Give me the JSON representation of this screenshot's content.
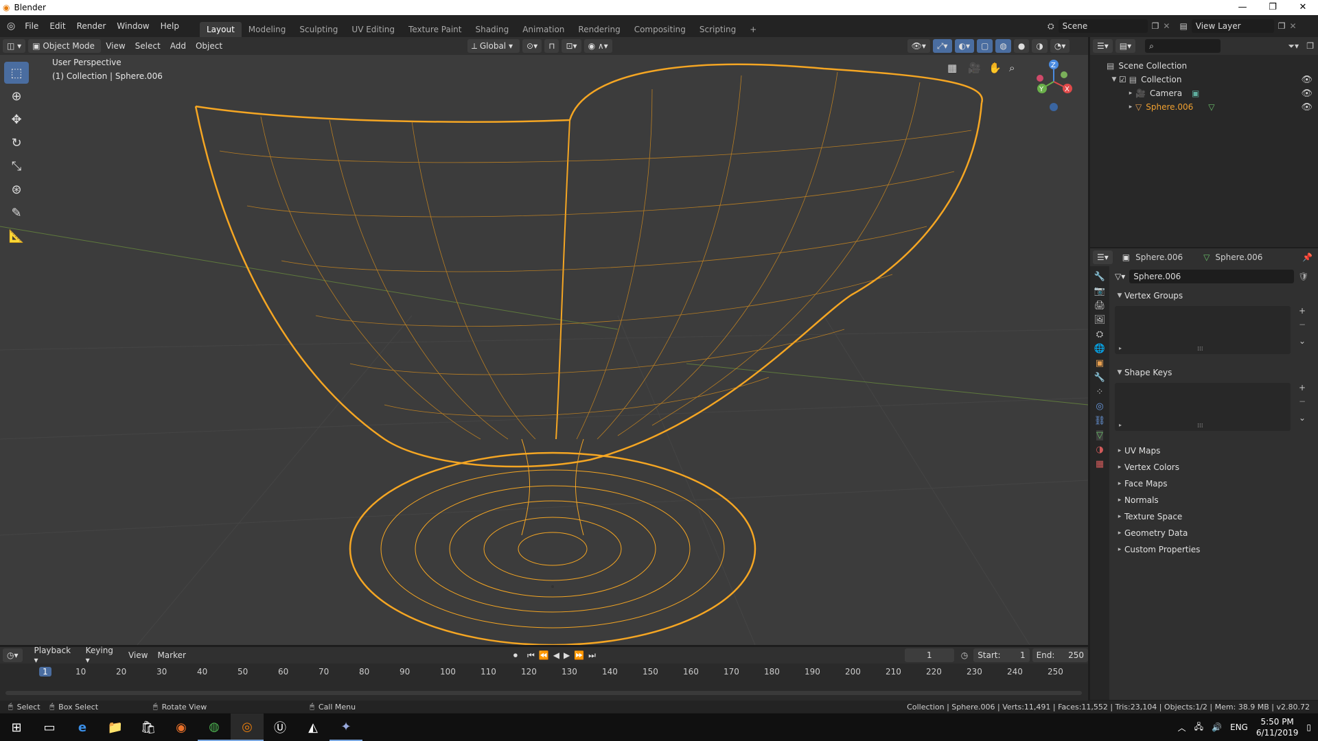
{
  "window": {
    "title": "Blender",
    "controls": [
      "—",
      "❐",
      "✕"
    ]
  },
  "menu": [
    "File",
    "Edit",
    "Render",
    "Window",
    "Help"
  ],
  "workspaces": [
    {
      "label": "Layout",
      "active": true
    },
    {
      "label": "Modeling"
    },
    {
      "label": "Sculpting"
    },
    {
      "label": "UV Editing"
    },
    {
      "label": "Texture Paint"
    },
    {
      "label": "Shading"
    },
    {
      "label": "Animation"
    },
    {
      "label": "Rendering"
    },
    {
      "label": "Compositing"
    },
    {
      "label": "Scripting"
    }
  ],
  "add_workspace": "+",
  "scene": {
    "name": "Scene",
    "view_layer": "View Layer"
  },
  "viewport_header": {
    "mode": "Object Mode",
    "menus": [
      "View",
      "Select",
      "Add",
      "Object"
    ],
    "orientation": "Global"
  },
  "viewport_overlay": {
    "perspective": "User Perspective",
    "collection_info": "(1) Collection | Sphere.006"
  },
  "gizmo": {
    "z": "Z",
    "y": "Y",
    "x": "X"
  },
  "outliner": {
    "root": "Scene Collection",
    "collection": "Collection",
    "items": [
      {
        "label": "Camera",
        "selected": false
      },
      {
        "label": "Sphere.006",
        "selected": true
      }
    ]
  },
  "properties": {
    "breadcrumb_object": "Sphere.006",
    "breadcrumb_data": "Sphere.006",
    "datablock": "Sphere.006",
    "panels_open": [
      "Vertex Groups",
      "Shape Keys"
    ],
    "panels_closed": [
      "UV Maps",
      "Vertex Colors",
      "Face Maps",
      "Normals",
      "Texture Space",
      "Geometry Data",
      "Custom Properties"
    ]
  },
  "timeline": {
    "menus": [
      "Playback",
      "Keying",
      "View",
      "Marker"
    ],
    "current_frame": "1",
    "start_label": "Start:",
    "start": "1",
    "end_label": "End:",
    "end": "250",
    "ticks": [
      "1",
      "10",
      "20",
      "30",
      "40",
      "50",
      "60",
      "70",
      "80",
      "90",
      "100",
      "110",
      "120",
      "130",
      "140",
      "150",
      "160",
      "170",
      "180",
      "190",
      "200",
      "210",
      "220",
      "230",
      "240",
      "250"
    ]
  },
  "status": {
    "select": "Select",
    "box_select": "Box Select",
    "rotate_view": "Rotate View",
    "call_menu": "Call Menu",
    "stats": "Collection | Sphere.006 | Verts:11,491 | Faces:11,552 | Tris:23,104 | Objects:1/2 | Mem: 38.9 MB | v2.80.72"
  },
  "taskbar": {
    "time": "5:50 PM",
    "date": "6/11/2019",
    "lang": "ENG"
  },
  "colors": {
    "wire": "#f5a623",
    "accent": "#4a6da0",
    "selected_text": "#f0a030"
  }
}
